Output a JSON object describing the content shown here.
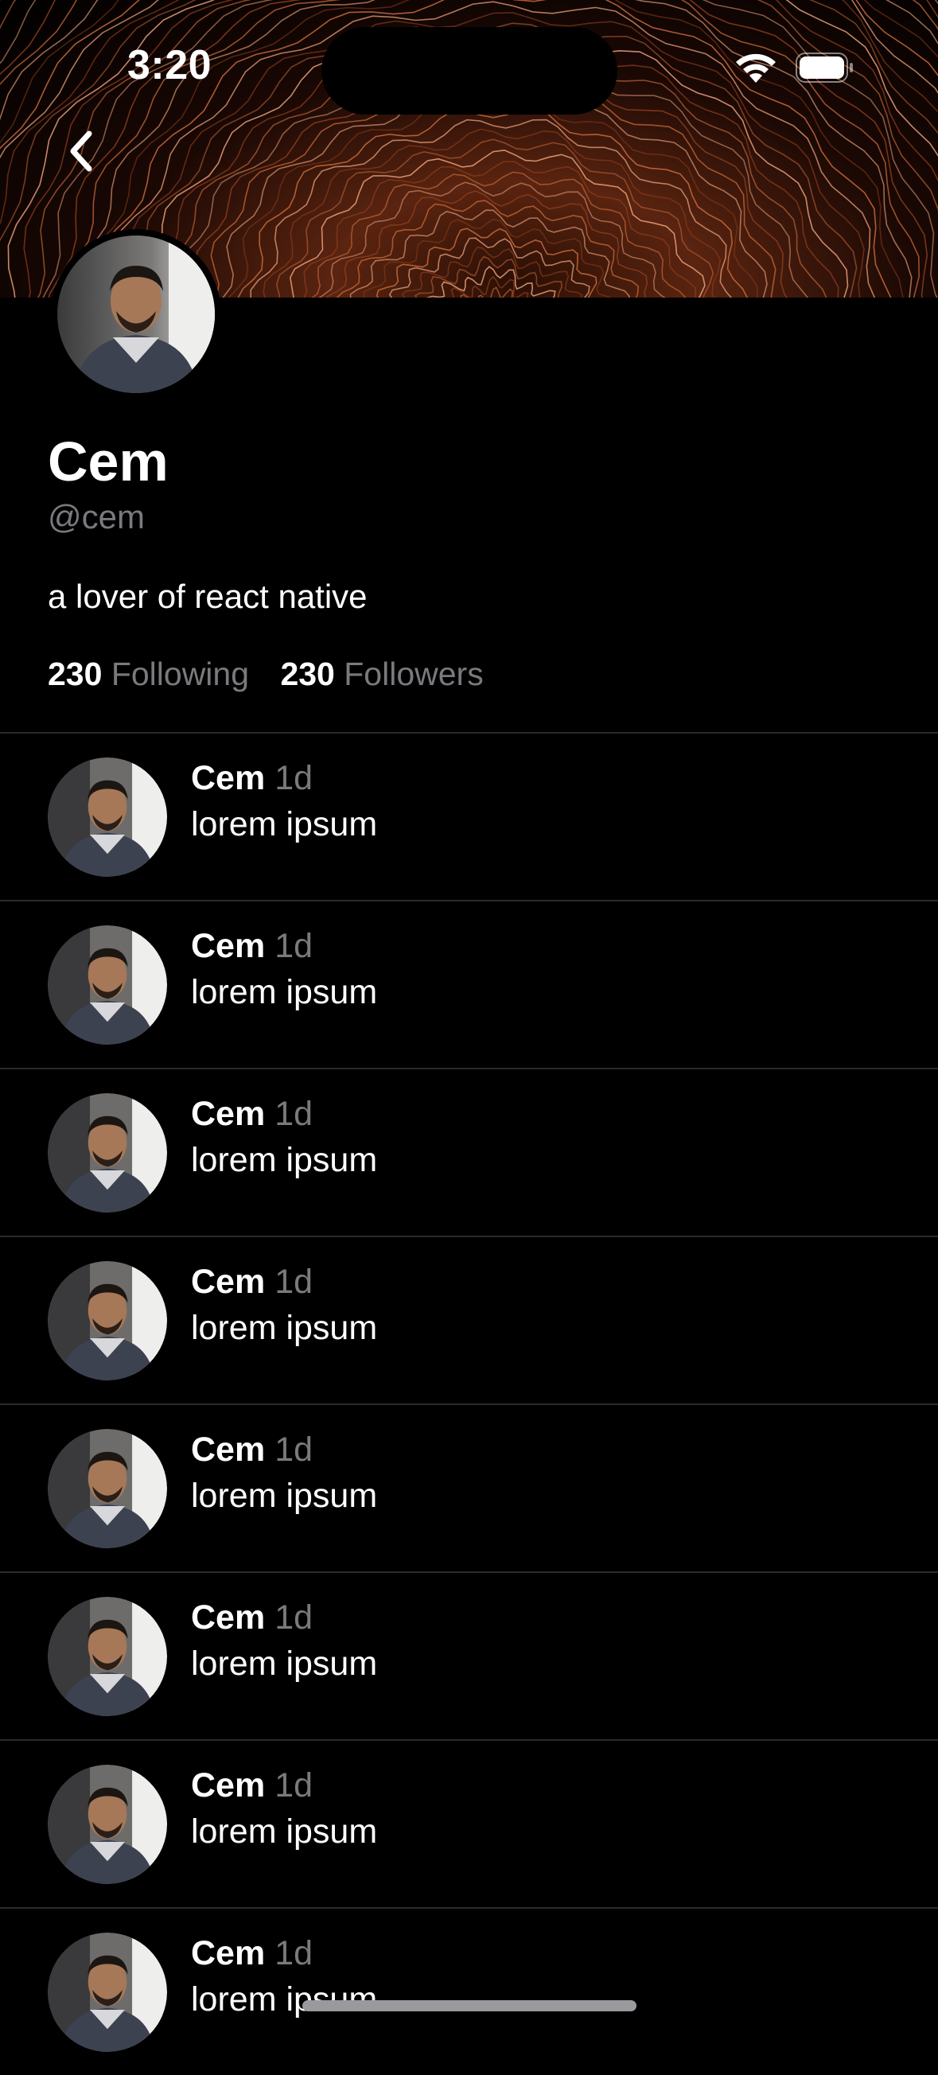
{
  "status_bar": {
    "time": "3:20",
    "icons": [
      "wifi-icon",
      "battery-icon"
    ]
  },
  "header": {
    "back_icon": "chevron-left-icon"
  },
  "profile": {
    "name": "Cem",
    "handle": "@cem",
    "bio": "a lover of react native",
    "following_count": "230",
    "following_label": "Following",
    "followers_count": "230",
    "followers_label": "Followers"
  },
  "feed": {
    "posts": [
      {
        "author": "Cem",
        "time": "1d",
        "text": "lorem ipsum"
      },
      {
        "author": "Cem",
        "time": "1d",
        "text": "lorem ipsum"
      },
      {
        "author": "Cem",
        "time": "1d",
        "text": "lorem ipsum"
      },
      {
        "author": "Cem",
        "time": "1d",
        "text": "lorem ipsum"
      },
      {
        "author": "Cem",
        "time": "1d",
        "text": "lorem ipsum"
      },
      {
        "author": "Cem",
        "time": "1d",
        "text": "lorem ipsum"
      },
      {
        "author": "Cem",
        "time": "1d",
        "text": "lorem ipsum"
      },
      {
        "author": "Cem",
        "time": "1d",
        "text": "lorem ipsum"
      }
    ]
  },
  "colors": {
    "background": "#000000",
    "text_primary": "#ffffff",
    "text_secondary": "#7a7a7e",
    "divider": "#2a2a2c",
    "cover_accent": "#c86a3a"
  }
}
